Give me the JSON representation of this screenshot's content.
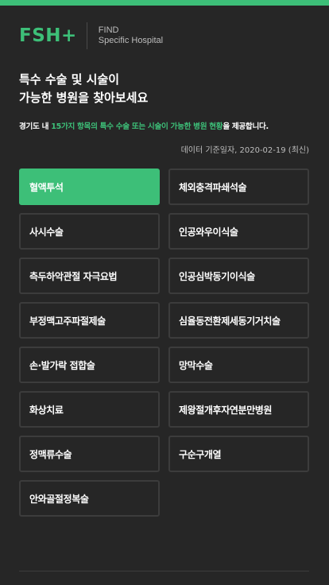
{
  "brand": {
    "logo": "FSH+",
    "tagline_line1": "FIND",
    "tagline_line2": "Specific Hospital",
    "accent_color": "#3dbf78"
  },
  "intro": {
    "headline_line1": "특수 수술 및 시술이",
    "headline_line2": "가능한 병원을 찾아보세요",
    "desc_pre": "경기도 내 ",
    "desc_hl1": "15가지 항목의 특수 수술 또는 시술이 가능한 병원 현황",
    "desc_post": "을 제공합니다.",
    "date": "데이터 기준일자, 2020-02-19 (최신)"
  },
  "procedures": [
    {
      "label": "혈액투석",
      "selected": true
    },
    {
      "label": "체외충격파쇄석술",
      "selected": false
    },
    {
      "label": "사시수술",
      "selected": false
    },
    {
      "label": "인공와우이식술",
      "selected": false
    },
    {
      "label": "측두하악관절 자극요법",
      "selected": false
    },
    {
      "label": "인공심박동기이식술",
      "selected": false
    },
    {
      "label": "부정맥고주파절제술",
      "selected": false
    },
    {
      "label": "심율동전환제세동기거치술",
      "selected": false
    },
    {
      "label": "손·발가락 접합술",
      "selected": false
    },
    {
      "label": "망막수술",
      "selected": false
    },
    {
      "label": "화상치료",
      "selected": false
    },
    {
      "label": "제왕절개후자연분만병원",
      "selected": false
    },
    {
      "label": "정맥류수술",
      "selected": false
    },
    {
      "label": "구순구개열",
      "selected": false
    },
    {
      "label": "안와골절정복술",
      "selected": false
    }
  ]
}
